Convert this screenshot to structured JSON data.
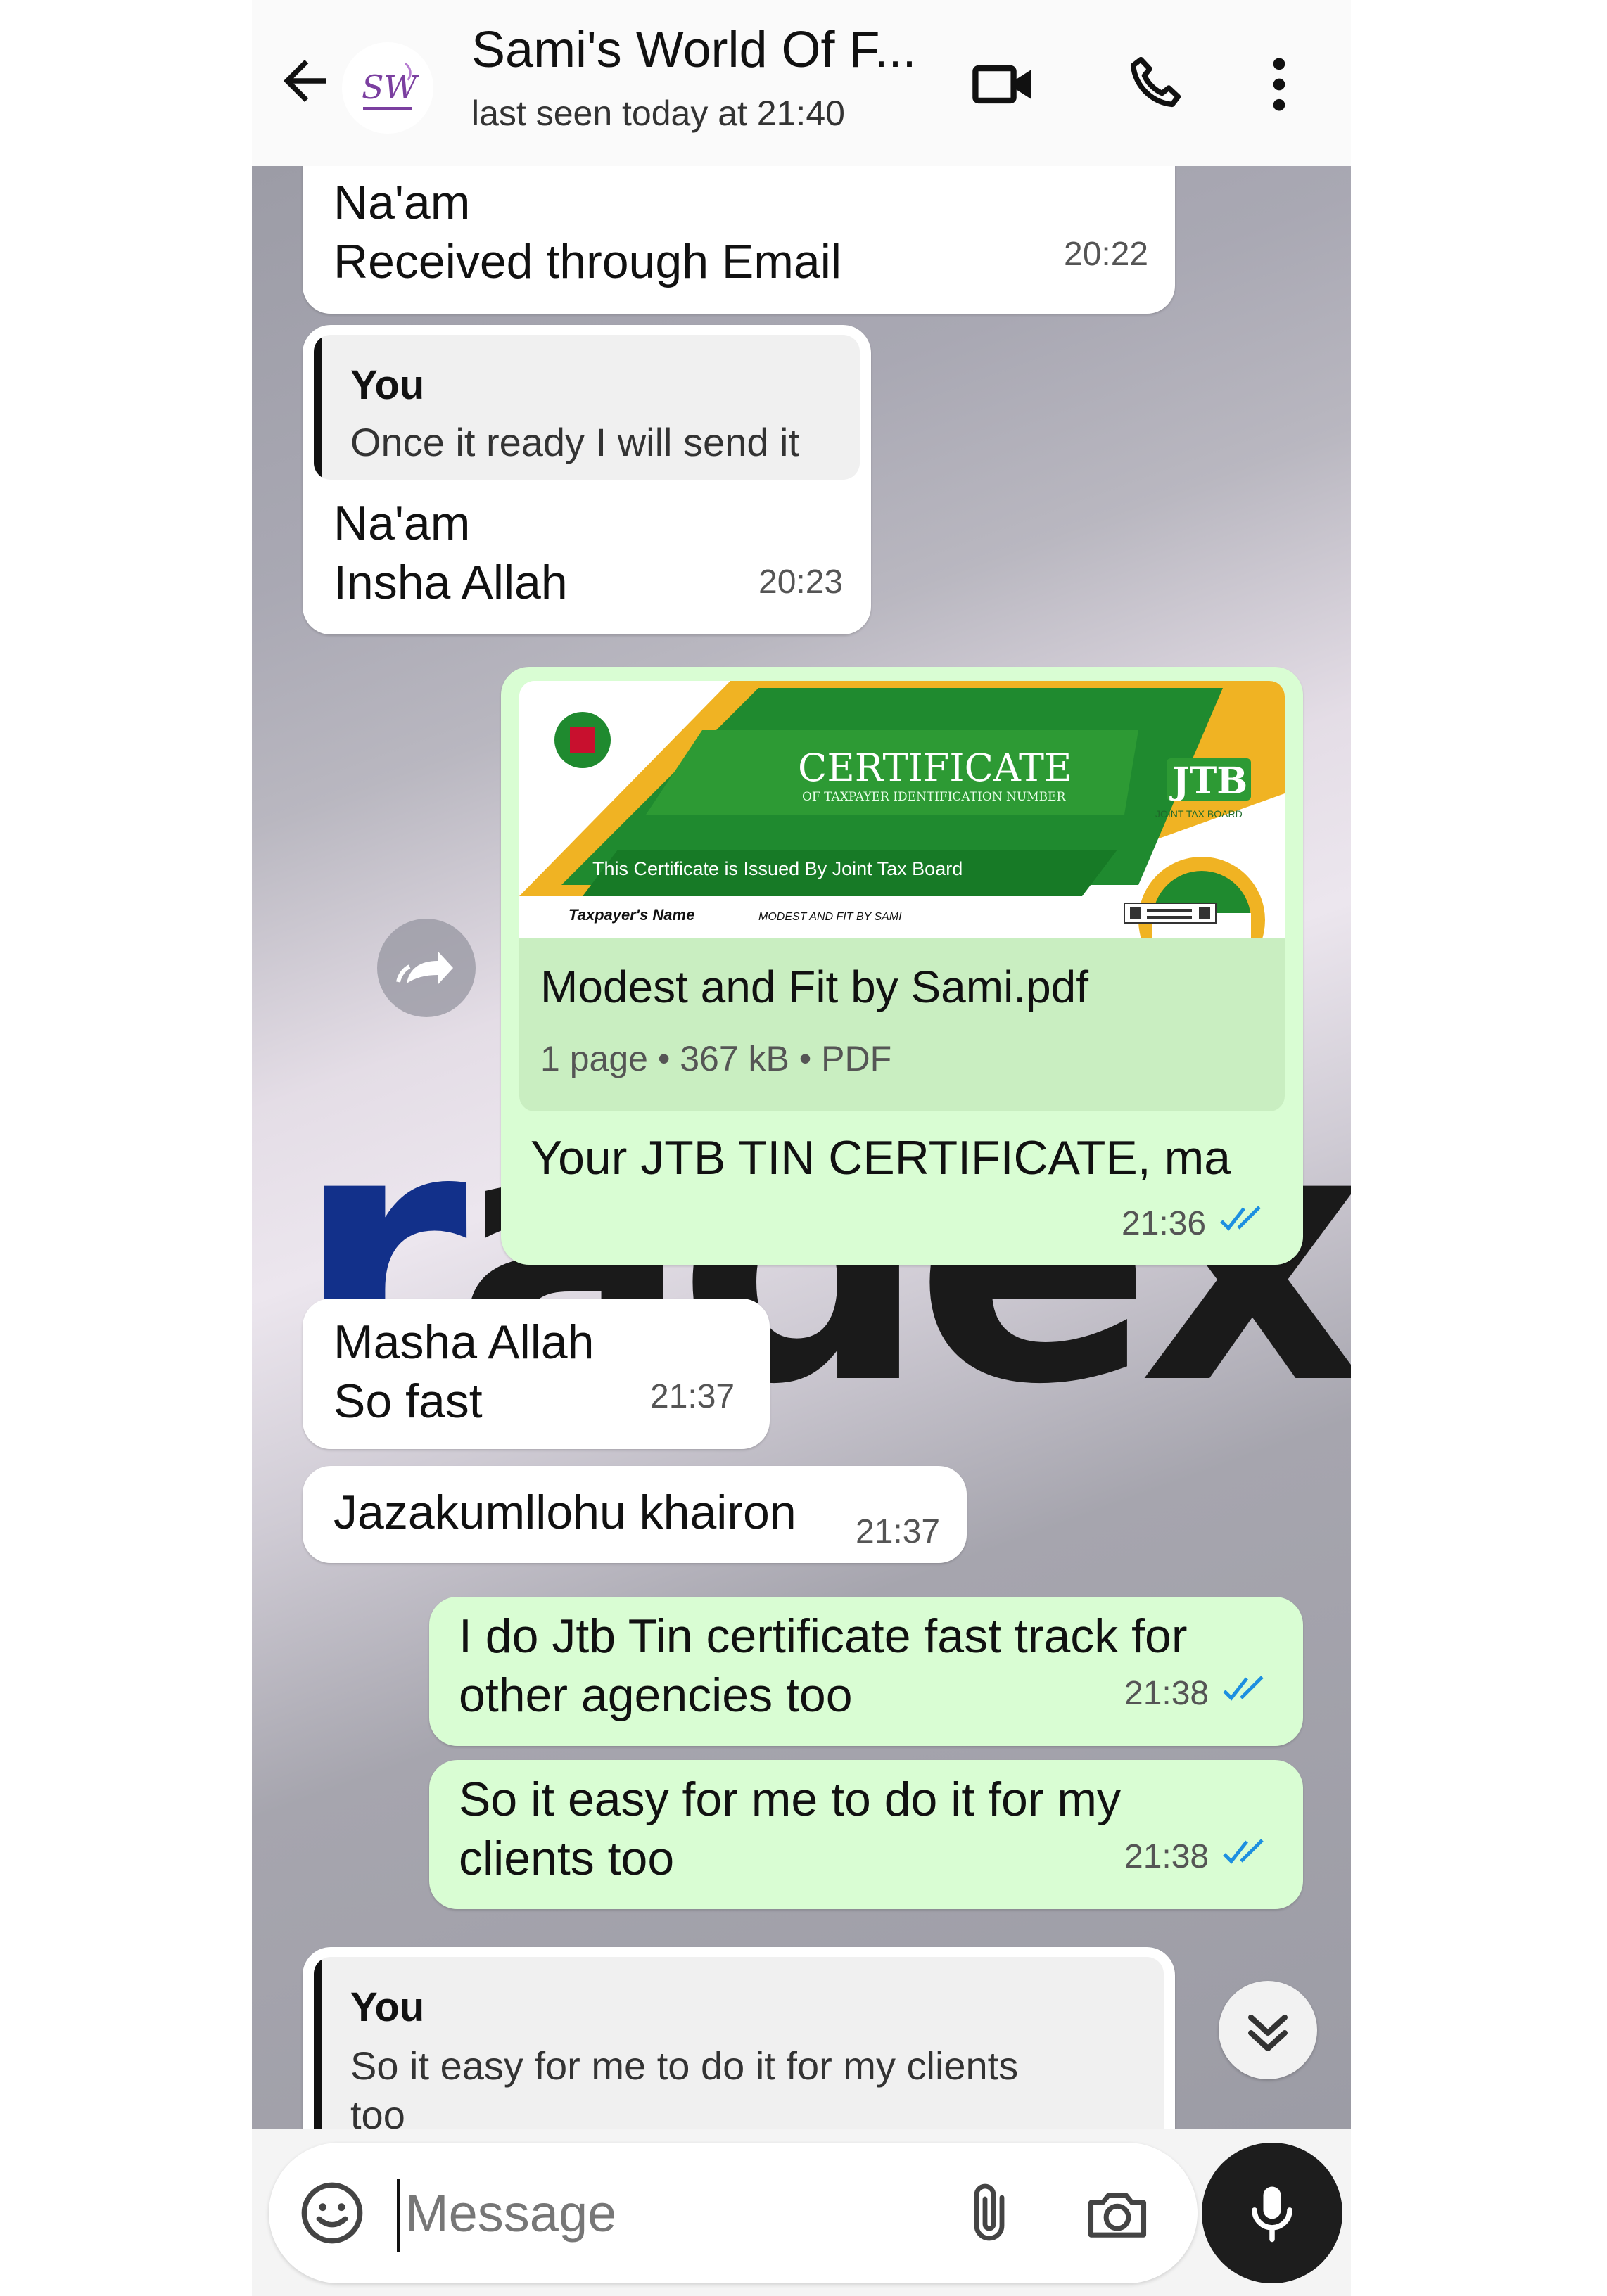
{
  "header": {
    "title": "Sami's World Of F...",
    "status": "last seen today at 21:40",
    "avatar_text": "SW"
  },
  "messages": [
    {
      "dir": "in",
      "text": "Na'am\nReceived through Email",
      "time": "20:22"
    },
    {
      "dir": "in",
      "quote_author": "You",
      "quote_text": "Once it ready I will send it",
      "text": "Na'am\nInsha Allah",
      "time": "20:23"
    },
    {
      "dir": "out",
      "doc": {
        "preview_title": "CERTIFICATE",
        "preview_subtitle": "OF TAXPAYER IDENTIFICATION NUMBER",
        "preview_banner": "This Certificate is Issued By Joint Tax Board",
        "preview_brand": "JTB",
        "preview_brand_sub": "JOINT TAX BOARD",
        "preview_name_label": "Taxpayer's Name",
        "preview_name_value": "MODEST AND FIT BY SAMI",
        "filename": "Modest and Fit by Sami.pdf",
        "meta": "1 page • 367 kB • PDF"
      },
      "text": "Your JTB TIN CERTIFICATE, ma",
      "time": "21:36",
      "read": true
    },
    {
      "dir": "in",
      "text": "Masha Allah\nSo fast",
      "time": "21:37"
    },
    {
      "dir": "in",
      "text": "Jazakumllohu khairon",
      "time": "21:37"
    },
    {
      "dir": "out",
      "text": "I do Jtb Tin certificate fast track for\nother agencies too",
      "time": "21:38",
      "read": true
    },
    {
      "dir": "out",
      "text": "So it easy for me to do it for my\nclients too",
      "time": "21:38",
      "read": true
    },
    {
      "dir": "in",
      "quote_author": "You",
      "quote_text": "So it easy for me to do it for my clients\ntoo"
    }
  ],
  "composer": {
    "placeholder": "Message"
  },
  "colors": {
    "outgoing": "#d9fdd3",
    "incoming": "#ffffff",
    "tick_read": "#1d8fe0",
    "mic_bg": "#1d1d1d"
  },
  "icons": [
    "back-arrow-icon",
    "video-call-icon",
    "voice-call-icon",
    "more-options-icon",
    "forward-icon",
    "scroll-down-icon",
    "emoji-icon",
    "attach-icon",
    "camera-icon",
    "mic-icon",
    "read-ticks-icon"
  ]
}
